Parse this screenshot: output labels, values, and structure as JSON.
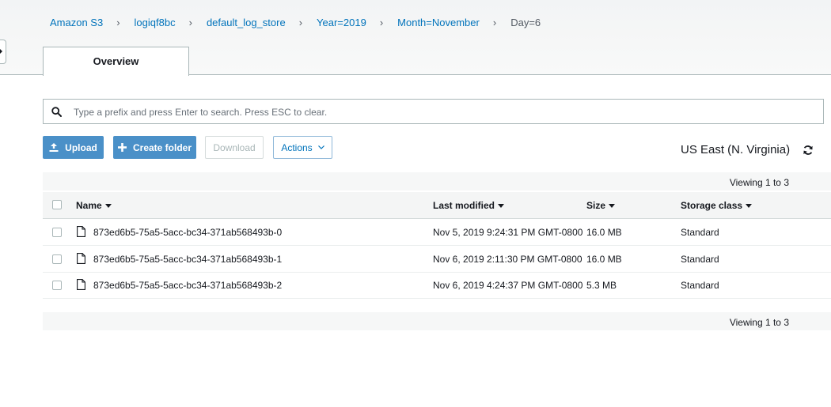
{
  "breadcrumb": [
    {
      "label": "Amazon S3",
      "link": true
    },
    {
      "label": "logiqf8bc",
      "link": true
    },
    {
      "label": "default_log_store",
      "link": true
    },
    {
      "label": "Year=2019",
      "link": true
    },
    {
      "label": "Month=November",
      "link": true
    },
    {
      "label": "Day=6",
      "link": false
    }
  ],
  "tabs": [
    {
      "label": "Overview",
      "active": true
    }
  ],
  "search": {
    "placeholder": "Type a prefix and press Enter to search. Press ESC to clear.",
    "value": ""
  },
  "toolbar": {
    "upload_label": "Upload",
    "create_folder_label": "Create folder",
    "download_label": "Download",
    "actions_label": "Actions"
  },
  "region": "US East (N. Virginia)",
  "viewing_top": "Viewing 1 to 3",
  "viewing_bottom": "Viewing 1 to 3",
  "table": {
    "columns": [
      "Name",
      "Last modified",
      "Size",
      "Storage class"
    ],
    "rows": [
      {
        "name": "873ed6b5-75a5-5acc-bc34-371ab568493b-0",
        "modified": "Nov 5, 2019 9:24:31 PM GMT-0800",
        "size": "16.0 MB",
        "storage": "Standard"
      },
      {
        "name": "873ed6b5-75a5-5acc-bc34-371ab568493b-1",
        "modified": "Nov 6, 2019 2:11:30 PM GMT-0800",
        "size": "16.0 MB",
        "storage": "Standard"
      },
      {
        "name": "873ed6b5-75a5-5acc-bc34-371ab568493b-2",
        "modified": "Nov 6, 2019 4:24:37 PM GMT-0800",
        "size": "5.3 MB",
        "storage": "Standard"
      }
    ]
  },
  "colors": {
    "link": "#0073bb",
    "primary_button": "#4a90c8",
    "border": "#aab7b8"
  },
  "icons": [
    "chevron-right-icon",
    "search-icon",
    "upload-icon",
    "plus-icon",
    "chevron-down-icon",
    "refresh-icon",
    "file-icon",
    "sort-caret-icon"
  ]
}
